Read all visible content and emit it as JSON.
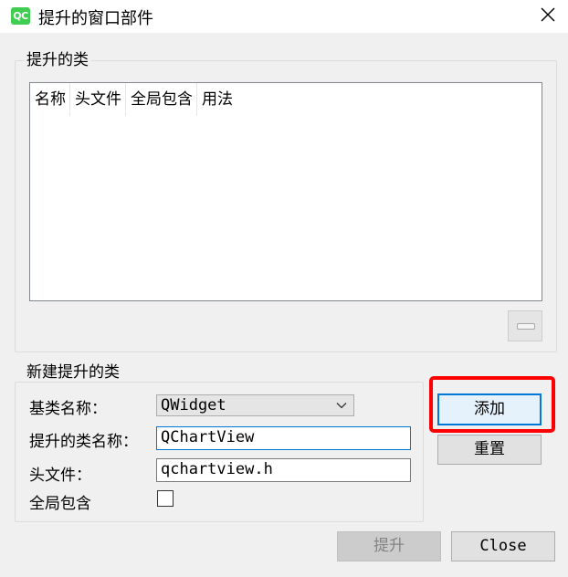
{
  "window": {
    "title": "提升的窗口部件",
    "icon": "qt-logo-icon",
    "icon_text": "QC",
    "icon_color": "#41cd52"
  },
  "promoted_group": {
    "title": "提升的类",
    "columns": [
      "名称",
      "头文件",
      "全局包含",
      "用法"
    ],
    "rows": []
  },
  "new_group": {
    "title": "新建提升的类",
    "base_class_label": "基类名称：",
    "base_class_value": "QWidget",
    "promoted_class_label": "提升的类名称：",
    "promoted_class_value": "QChartView",
    "header_file_label": "头文件：",
    "header_file_value": "qchartview.h",
    "global_include_label": "全局包含",
    "global_include_checked": false
  },
  "buttons": {
    "add": "添加",
    "reset": "重置",
    "promote": "提升",
    "close": "Close"
  },
  "colors": {
    "accent": "#0078d7",
    "highlight": "#ff0000"
  }
}
